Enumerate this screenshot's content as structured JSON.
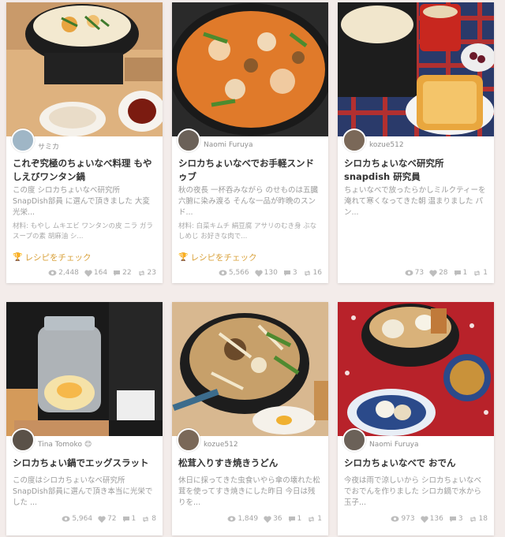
{
  "cards": [
    {
      "author": "サミカ",
      "title": "これぞ究極のちょいなべ料理 もやしえびワンタン鍋",
      "description": "この度 シロカちょいなべ研究所 SnapDish部員 に選んで頂きました 大変光栄...",
      "ingredients": "材料: もやし ムキエビ ワンタンの皮 ニラ ガラスープの素 胡麻油 シ...",
      "recipe_link": "レシピをチェック",
      "stats": {
        "views": "2,448",
        "likes": "164",
        "comments": "22",
        "reposts": "23"
      }
    },
    {
      "author": "Naomi Furuya",
      "title": "シロカちょいなべでお手軽スンドゥブ",
      "description": "秋の夜長 一杯呑みながら のせものは五臓六腑に染み渡る そんな一品が昨晩のスンド...",
      "ingredients": "材料: 白菜キムチ 絹豆腐 アサリのむき身 ぶなしめじ お好きな肉で...",
      "recipe_link": "レシピをチェック",
      "stats": {
        "views": "5,566",
        "likes": "130",
        "comments": "3",
        "reposts": "16"
      }
    },
    {
      "author": "kozue512",
      "title": "シロカちょいなべ研究所 snapdish 研究員",
      "description": "ちょいなべで放ったらかしミルクティーを淹れて寒くなってきた朝 温まりました パン...",
      "ingredients": "",
      "recipe_link": "",
      "stats": {
        "views": "73",
        "likes": "28",
        "comments": "1",
        "reposts": "1"
      }
    },
    {
      "author": "Tina Tomoko",
      "title": "シロカちょい鍋でエッグスラット",
      "description": "この度はシロカちょいなべ研究所 SnapDish部員に選んで頂き本当に光栄でした ...",
      "ingredients": "",
      "recipe_link": "",
      "stats": {
        "views": "5,964",
        "likes": "72",
        "comments": "1",
        "reposts": "8"
      }
    },
    {
      "author": "kozue512",
      "title": "松茸入りすき焼きうどん",
      "description": "休日に採ってきた虫食いやら傘の壊れた松茸を使ってすき焼きにした昨日 今日は残りを...",
      "ingredients": "",
      "recipe_link": "",
      "stats": {
        "views": "1,849",
        "likes": "36",
        "comments": "1",
        "reposts": "1"
      }
    },
    {
      "author": "Naomi Furuya",
      "title": "シロカちょいなべで おでん",
      "description": "今夜は雨で涼しいから シロカちょいなべでおでんを作りました シロカ鍋で水から玉子...",
      "ingredients": "",
      "recipe_link": "",
      "stats": {
        "views": "973",
        "likes": "136",
        "comments": "3",
        "reposts": "18"
      }
    }
  ]
}
